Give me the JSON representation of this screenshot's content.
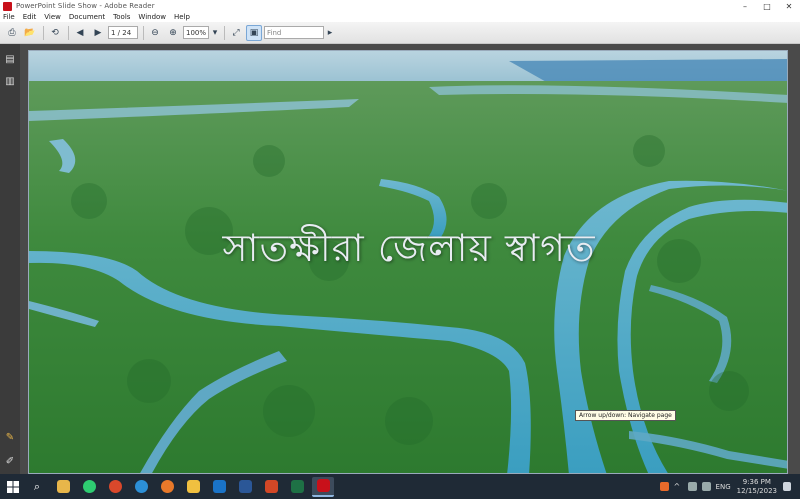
{
  "window": {
    "title": "PowerPoint Slide Show - Adobe Reader",
    "controls": [
      "–",
      "□",
      "✕"
    ]
  },
  "menu": [
    "File",
    "Edit",
    "View",
    "Document",
    "Tools",
    "Window",
    "Help"
  ],
  "toolbar": {
    "page_field": "1 / 24",
    "zoom_field": "100%",
    "search_placeholder": "Find"
  },
  "slide": {
    "title": "সাতক্ষীরা জেলায় স্বাগত",
    "tooltip": "Arrow up/down: Navigate page"
  },
  "colors": {
    "forest": "#2f7d3a",
    "river": "#3f9fbf",
    "sky": "#9fc7d8",
    "taskbar": "#1f2a36"
  },
  "taskbar": {
    "apps": [
      {
        "name": "file-explorer",
        "color": "#e8b64a"
      },
      {
        "name": "whatsapp",
        "color": "#2ecc71"
      },
      {
        "name": "chrome",
        "color": "#d9482b"
      },
      {
        "name": "edge",
        "color": "#2c8fd6"
      },
      {
        "name": "firefox",
        "color": "#e8792a"
      },
      {
        "name": "folder",
        "color": "#f0c040"
      },
      {
        "name": "outlook",
        "color": "#1a73c7"
      },
      {
        "name": "word",
        "color": "#2b5797"
      },
      {
        "name": "powerpoint",
        "color": "#d24726"
      },
      {
        "name": "excel",
        "color": "#1e7145"
      },
      {
        "name": "adobe-reader",
        "color": "#c8101a"
      }
    ],
    "time": "9:36 PM",
    "date": "12/15/2023",
    "language": "ENG"
  }
}
